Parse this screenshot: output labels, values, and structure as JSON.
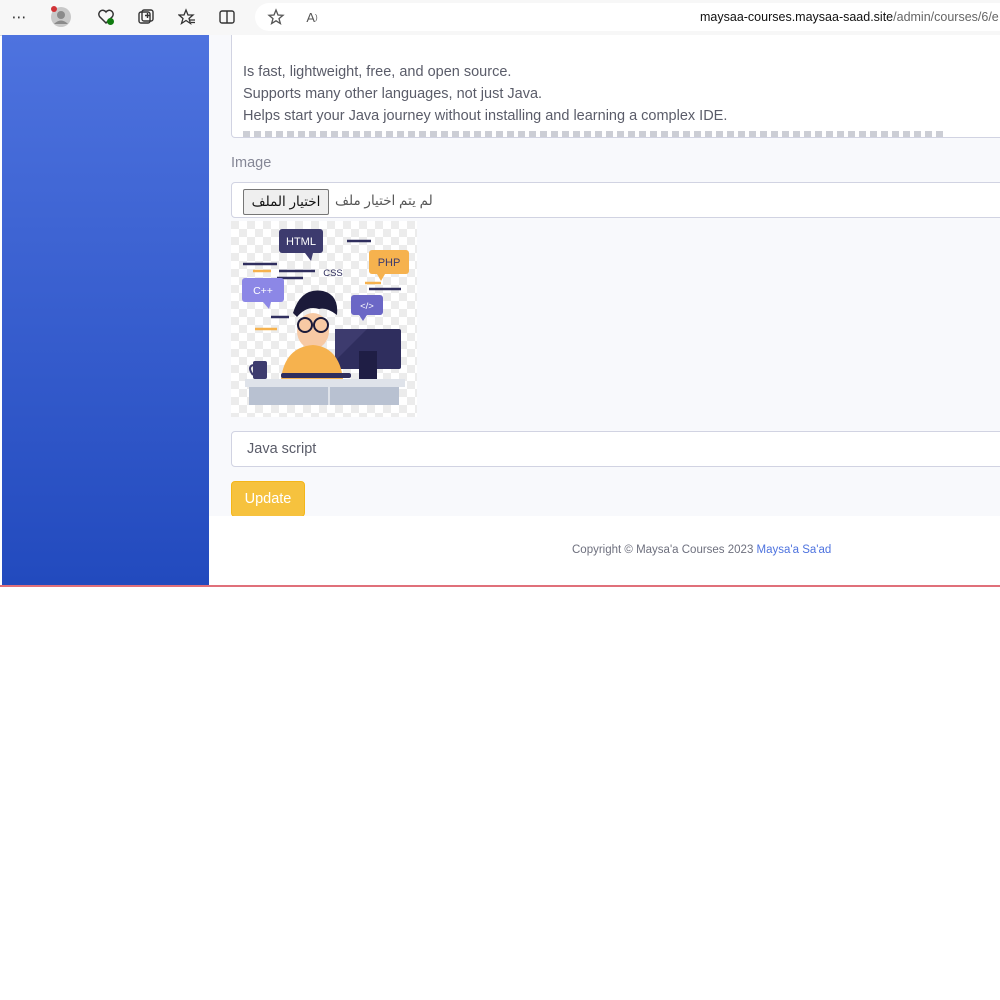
{
  "browser": {
    "url_host": "maysaa-courses.maysaa-saad.site",
    "url_path": "/admin/courses/6/e",
    "icons": [
      "more-icon",
      "profile-avatar-icon",
      "heart-health-icon",
      "collections-icon",
      "favorites-icon",
      "split-screen-icon",
      "star-icon",
      "read-aloud-icon"
    ]
  },
  "form": {
    "description_lines": [
      "Is fast, lightweight, free, and open source.",
      "Supports many other languages, not just Java.",
      "Helps start your Java journey without installing and learning a complex IDE."
    ],
    "image_label": "Image",
    "file_button": "اختيار الملف",
    "file_status": "لم يتم اختيار ملف",
    "preview_tags": {
      "html": "HTML",
      "css": "CSS",
      "php": "PHP",
      "cpp": "C++",
      "code": "</>"
    },
    "title_value": "Java script",
    "update_button": "Update"
  },
  "footer": {
    "copyright_text": "Copyright © Maysa'a Courses 2023",
    "author_link": "Maysa'a Sa'ad"
  },
  "colors": {
    "sidebar_top": "#4e73df",
    "sidebar_bottom": "#224abe",
    "update_button": "#f6c23e",
    "link": "#4e73df"
  }
}
